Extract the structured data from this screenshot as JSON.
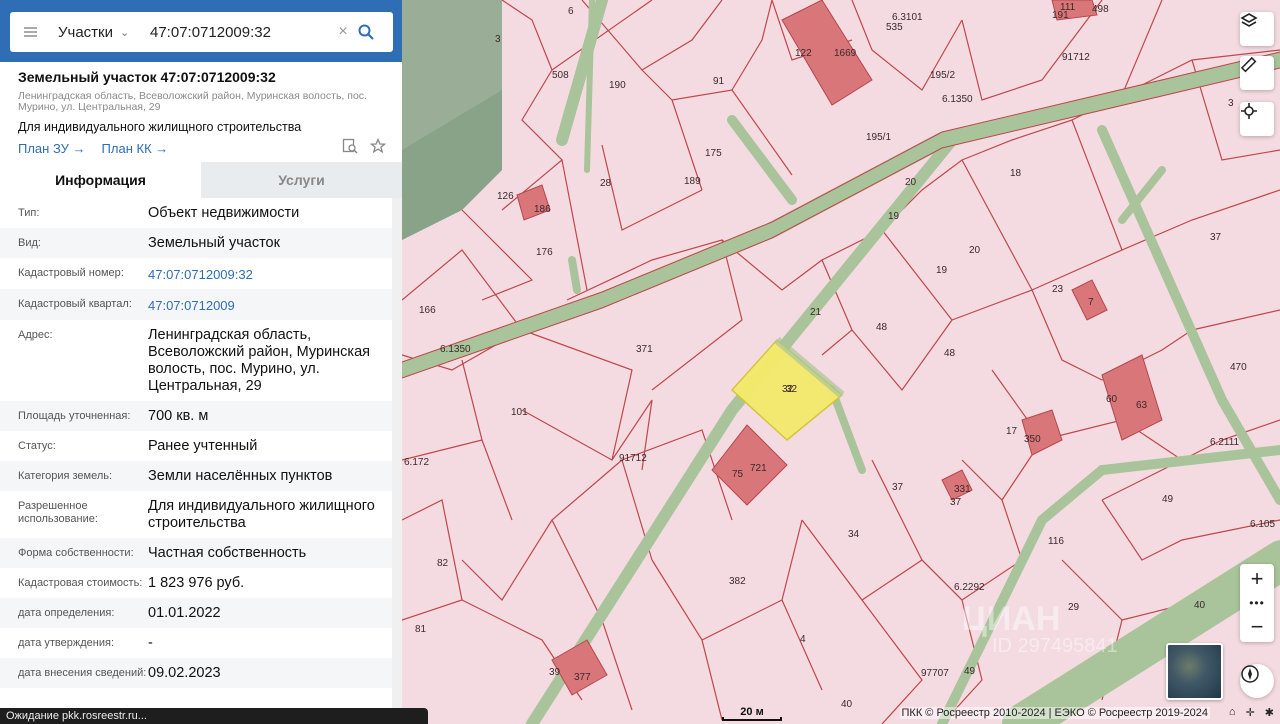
{
  "search": {
    "type_label": "Участки",
    "query": "47:07:0712009:32"
  },
  "header": {
    "title": "Земельный участок 47:07:0712009:32",
    "address_small": "Ленинградская область, Всеволожский район, Муринская волость, пос. Мурино, ул. Центральная, 29",
    "purpose": "Для индивидуального жилищного строительства",
    "link_zu": "План ЗУ",
    "link_kk": "План КК"
  },
  "tabs": [
    {
      "label": "Информация",
      "active": true
    },
    {
      "label": "Услуги",
      "active": false
    }
  ],
  "info": [
    {
      "key": "Тип:",
      "value": "Объект недвижимости"
    },
    {
      "key": "Вид:",
      "value": "Земельный участок"
    },
    {
      "key": "Кадастровый номер:",
      "value": "47:07:0712009:32",
      "link": true
    },
    {
      "key": "Кадастровый квартал:",
      "value": "47:07:0712009",
      "link": true
    },
    {
      "key": "Адрес:",
      "value": "Ленинградская область, Всеволожский район, Муринская волость, пос. Мурино, ул. Центральная, 29"
    },
    {
      "key": "Площадь уточненная:",
      "value": "700 кв. м"
    },
    {
      "key": "Статус:",
      "value": "Ранее учтенный"
    },
    {
      "key": "Категория земель:",
      "value": "Земли населённых пунктов"
    },
    {
      "key": "Разрешенное использование:",
      "value": "Для индивидуального жилищного строительства"
    },
    {
      "key": "Форма собственности:",
      "value": "Частная собственность"
    },
    {
      "key": "Кадастровая стоимость:",
      "value": "1 823 976 руб."
    },
    {
      "key": "дата определения:",
      "value": "01.01.2022"
    },
    {
      "key": "дата утверждения:",
      "value": "-"
    },
    {
      "key": "дата внесения сведений:",
      "value": "09.02.2023"
    }
  ],
  "status_bar": "Ожидание pkk.rosreestr.ru...",
  "map": {
    "scale_label": "20 м",
    "copyright": "ПКК © Росреестр 2010-2024 | ЕЭКО © Росреестр 2019-2024",
    "parcel_labels": [
      "6",
      "3",
      "508",
      "190",
      "91",
      "122",
      "1669",
      "535",
      "6.3101",
      "111",
      "498",
      "191",
      "91712",
      "195/2",
      "6.1350",
      "28",
      "189",
      "175",
      "126",
      "186",
      "176",
      "195/1",
      "20",
      "18",
      "3",
      "19",
      "20",
      "37",
      "166",
      "6.1350",
      "371",
      "21",
      "48",
      "23",
      "7",
      "19",
      "48",
      "101",
      "32",
      "60",
      "63",
      "470",
      "17",
      "350",
      "6.2111",
      "91712",
      "75",
      "721",
      "37",
      "331",
      "37",
      "49",
      "6.172",
      "34",
      "116",
      "6.105",
      "382",
      "82",
      "6.2292",
      "4",
      "29",
      "40",
      "81",
      "39",
      "377",
      "97707",
      "49",
      "40"
    ],
    "highlight_label": "32"
  },
  "colors": {
    "brand_blue": "#2f6db5",
    "parcel_fill": "#f4dbe2",
    "parcel_border": "#c0474a",
    "building": "#d9767a",
    "highlight": "#f5ea6a",
    "road": "#a9c49a"
  }
}
